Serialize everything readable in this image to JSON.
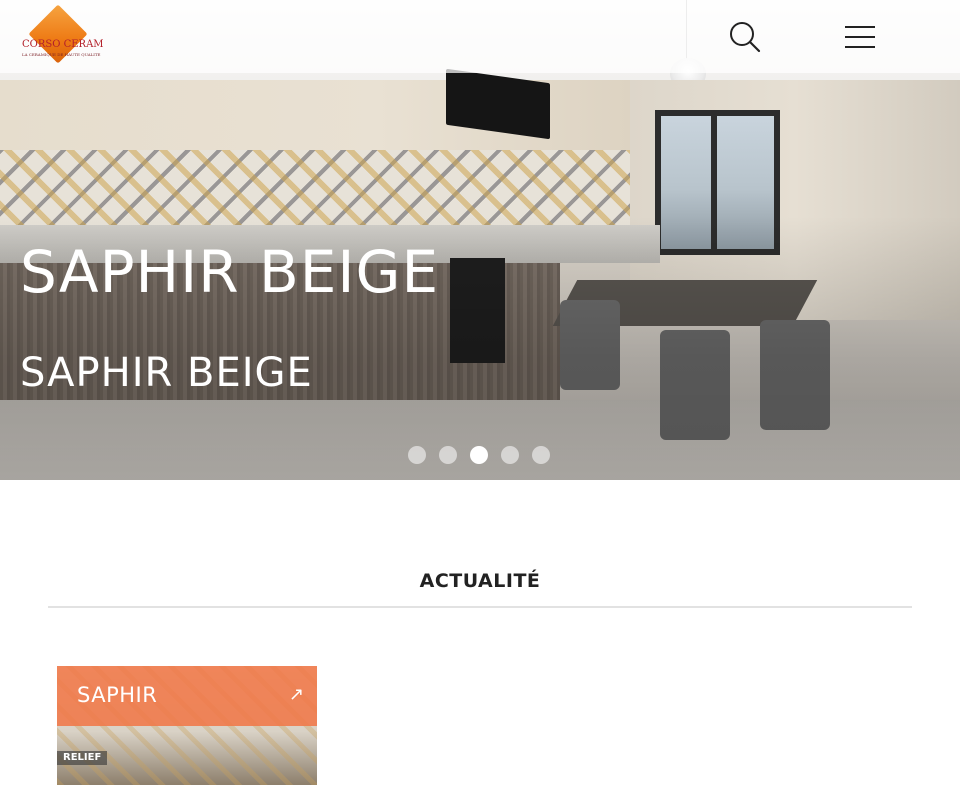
{
  "header": {
    "logo_text": "CORSO CERAM",
    "logo_tagline": "LA CERAMIQUE DE HAUTE QUALITE",
    "search_icon": "search-icon",
    "menu_icon": "hamburger-menu-icon"
  },
  "hero": {
    "title": "SAPHIR BEIGE",
    "subtitle": "SAPHIR BEIGE",
    "slide_count": 5,
    "active_slide": 3
  },
  "news": {
    "section_title": "ACTUALITÉ",
    "cards": [
      {
        "title": "SAPHIR",
        "arrow_icon": "arrow-up-right-icon",
        "badge": "RELIEF"
      }
    ]
  },
  "colors": {
    "accent": "#f07848",
    "logo_orange": "#ee7a14",
    "logo_red": "#b3202a"
  }
}
